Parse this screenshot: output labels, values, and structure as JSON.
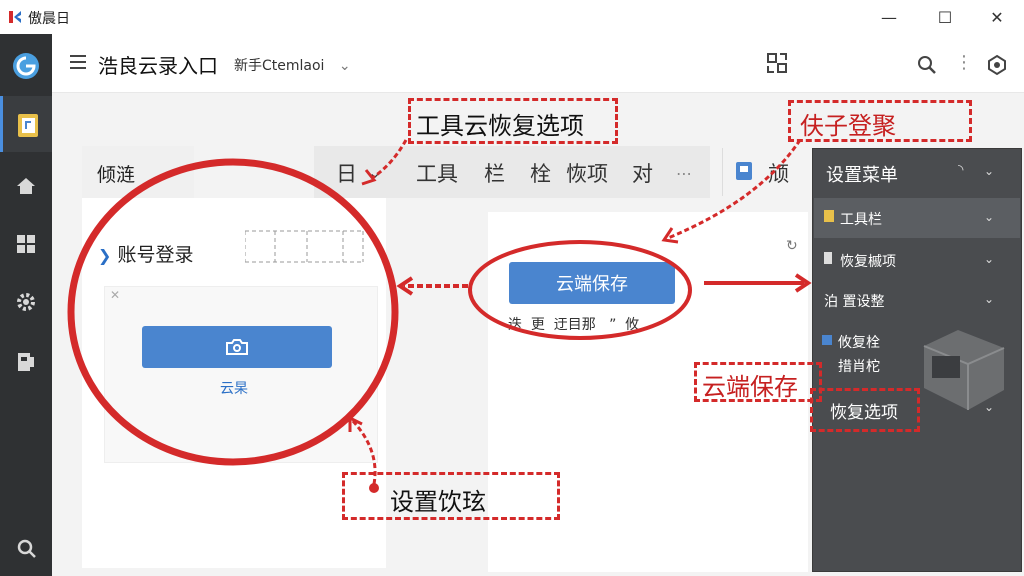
{
  "window": {
    "title": "傲晨日",
    "minimize": "—",
    "maximize": "☐",
    "close": "✕"
  },
  "header": {
    "title": "浩良云录入口",
    "account": "新手Ctemlaoi",
    "account_chevron": "⌄"
  },
  "toolbar": {
    "left_tab": "倾涟",
    "items": [
      "日",
      "⌄",
      "工具",
      "栏",
      "栓",
      "恢项",
      "对",
      "⋯",
      "颃"
    ]
  },
  "left_panel": {
    "account_login": "账号登录",
    "cloud_link": "云杲"
  },
  "middle_panel": {
    "save_button": "云端保存",
    "sub_text": "迭  更  迂目那   ”  攸"
  },
  "settings": {
    "title": "设置菜单",
    "items": [
      {
        "label": "工具栏"
      },
      {
        "label": "恢复槭项"
      },
      {
        "label": "泊 置设整"
      },
      {
        "label": "攸复栓"
      },
      {
        "label": "措肖柁"
      },
      {
        "label": "恢复选项"
      }
    ]
  },
  "annotations": {
    "top_label": "工具云恢复选项",
    "top_right_label": "伕子登聚",
    "cloud_save_label": "云端保存",
    "bottom_label": "设置饮玹"
  },
  "colors": {
    "accent": "#4a85cf",
    "annotation_red": "#d42a2a",
    "rail": "#2f3133",
    "settings_panel": "#4a4c4f"
  }
}
